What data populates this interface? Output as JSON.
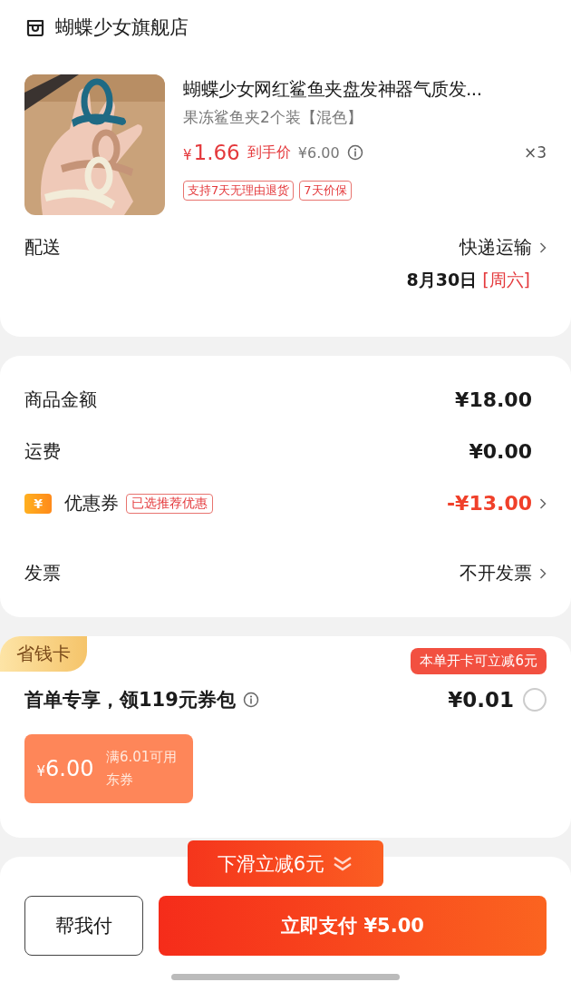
{
  "store": {
    "name": "蝴蝶少女旗舰店"
  },
  "product": {
    "title": "蝴蝶少女网红鲨鱼夹盘发神器气质发...",
    "spec": "果冻鲨鱼夹2个装【混色】",
    "price": {
      "currency": "¥",
      "amount": "1.66"
    },
    "price_label": "到手价",
    "original_price": "¥6.00",
    "quantity": "×3",
    "tags": [
      "支持7天无理由退货",
      "7天价保"
    ]
  },
  "delivery": {
    "label": "配送",
    "method": "快递运输",
    "date": "8月30日",
    "weekday": "[周六]"
  },
  "summary": [
    {
      "kind": "amount",
      "label": "商品金额",
      "value": "¥18.00"
    },
    {
      "kind": "amount",
      "label": "运费",
      "value": "¥0.00"
    },
    {
      "kind": "coupon",
      "icon_text": "¥",
      "label": "优惠券",
      "badge": "已选推荐优惠",
      "value": "-¥13.00"
    },
    {
      "kind": "link",
      "label": "发票",
      "value": "不开发票"
    }
  ],
  "savings_card": {
    "tag": "省钱卡",
    "title": "首单专享，领119元券包",
    "tooltip": "本单开卡可立减6元",
    "price": "¥0.01",
    "selected": false,
    "voucher": {
      "currency": "¥",
      "amount": "6.00",
      "condition": "满6.01可用",
      "type": "东券"
    }
  },
  "promo_banner": {
    "text": "下滑立减6元"
  },
  "footer": {
    "secondary": "帮我付",
    "primary": "立即支付 ¥5.00"
  }
}
